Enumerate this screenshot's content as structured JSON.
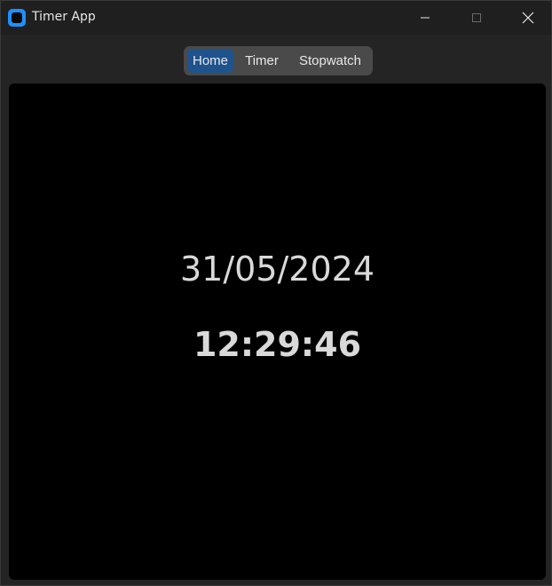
{
  "window": {
    "title": "Timer App",
    "icon": "app-icon",
    "controls": {
      "minimize_icon": "minimize-icon",
      "maximize_icon": "maximize-icon",
      "close_icon": "close-icon"
    }
  },
  "tabs": [
    {
      "label": "Home",
      "active": true
    },
    {
      "label": "Timer",
      "active": false
    },
    {
      "label": "Stopwatch",
      "active": false
    }
  ],
  "home": {
    "date": "31/05/2024",
    "time": "12:29:46"
  },
  "colors": {
    "accent": "#1f538d",
    "app_icon": "#1e90ff",
    "background": "#000000",
    "text": "#d9d9d9"
  }
}
